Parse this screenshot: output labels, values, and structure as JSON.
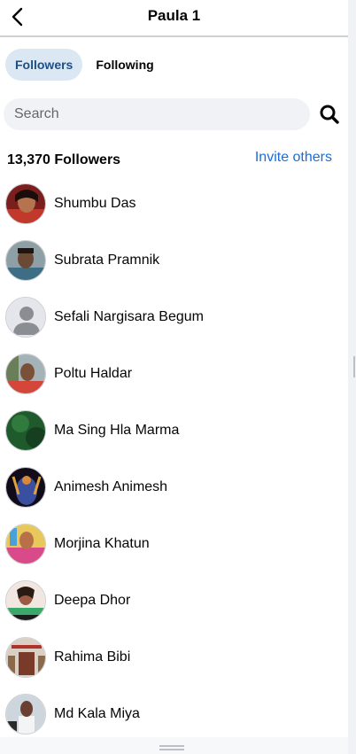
{
  "header": {
    "title": "Paula 1",
    "back_icon": "chevron-left-icon"
  },
  "tabs": [
    {
      "label": "Followers",
      "active": true
    },
    {
      "label": "Following",
      "active": false
    }
  ],
  "search": {
    "placeholder": "Search",
    "value": "",
    "icon": "search-icon"
  },
  "followers_count": "13,370 Followers",
  "invite_label": "Invite others",
  "colors": {
    "accent": "#1a6ed8",
    "active_tab_bg": "#dbe7f2",
    "search_bg": "#f0f2f5"
  },
  "followers": [
    {
      "name": "Shumbu Das",
      "avatar": "photo"
    },
    {
      "name": "Subrata Pramnik",
      "avatar": "photo"
    },
    {
      "name": "Sefali Nargisara Begum",
      "avatar": "default-user-icon"
    },
    {
      "name": "Poltu Haldar",
      "avatar": "photo"
    },
    {
      "name": "Ma Sing Hla Marma",
      "avatar": "photo"
    },
    {
      "name": "Animesh Animesh",
      "avatar": "photo"
    },
    {
      "name": "Morjina Khatun",
      "avatar": "photo"
    },
    {
      "name": "Deepa Dhor",
      "avatar": "photo"
    },
    {
      "name": "Rahima Bibi",
      "avatar": "photo"
    },
    {
      "name": "Md Kala Miya",
      "avatar": "photo"
    }
  ]
}
